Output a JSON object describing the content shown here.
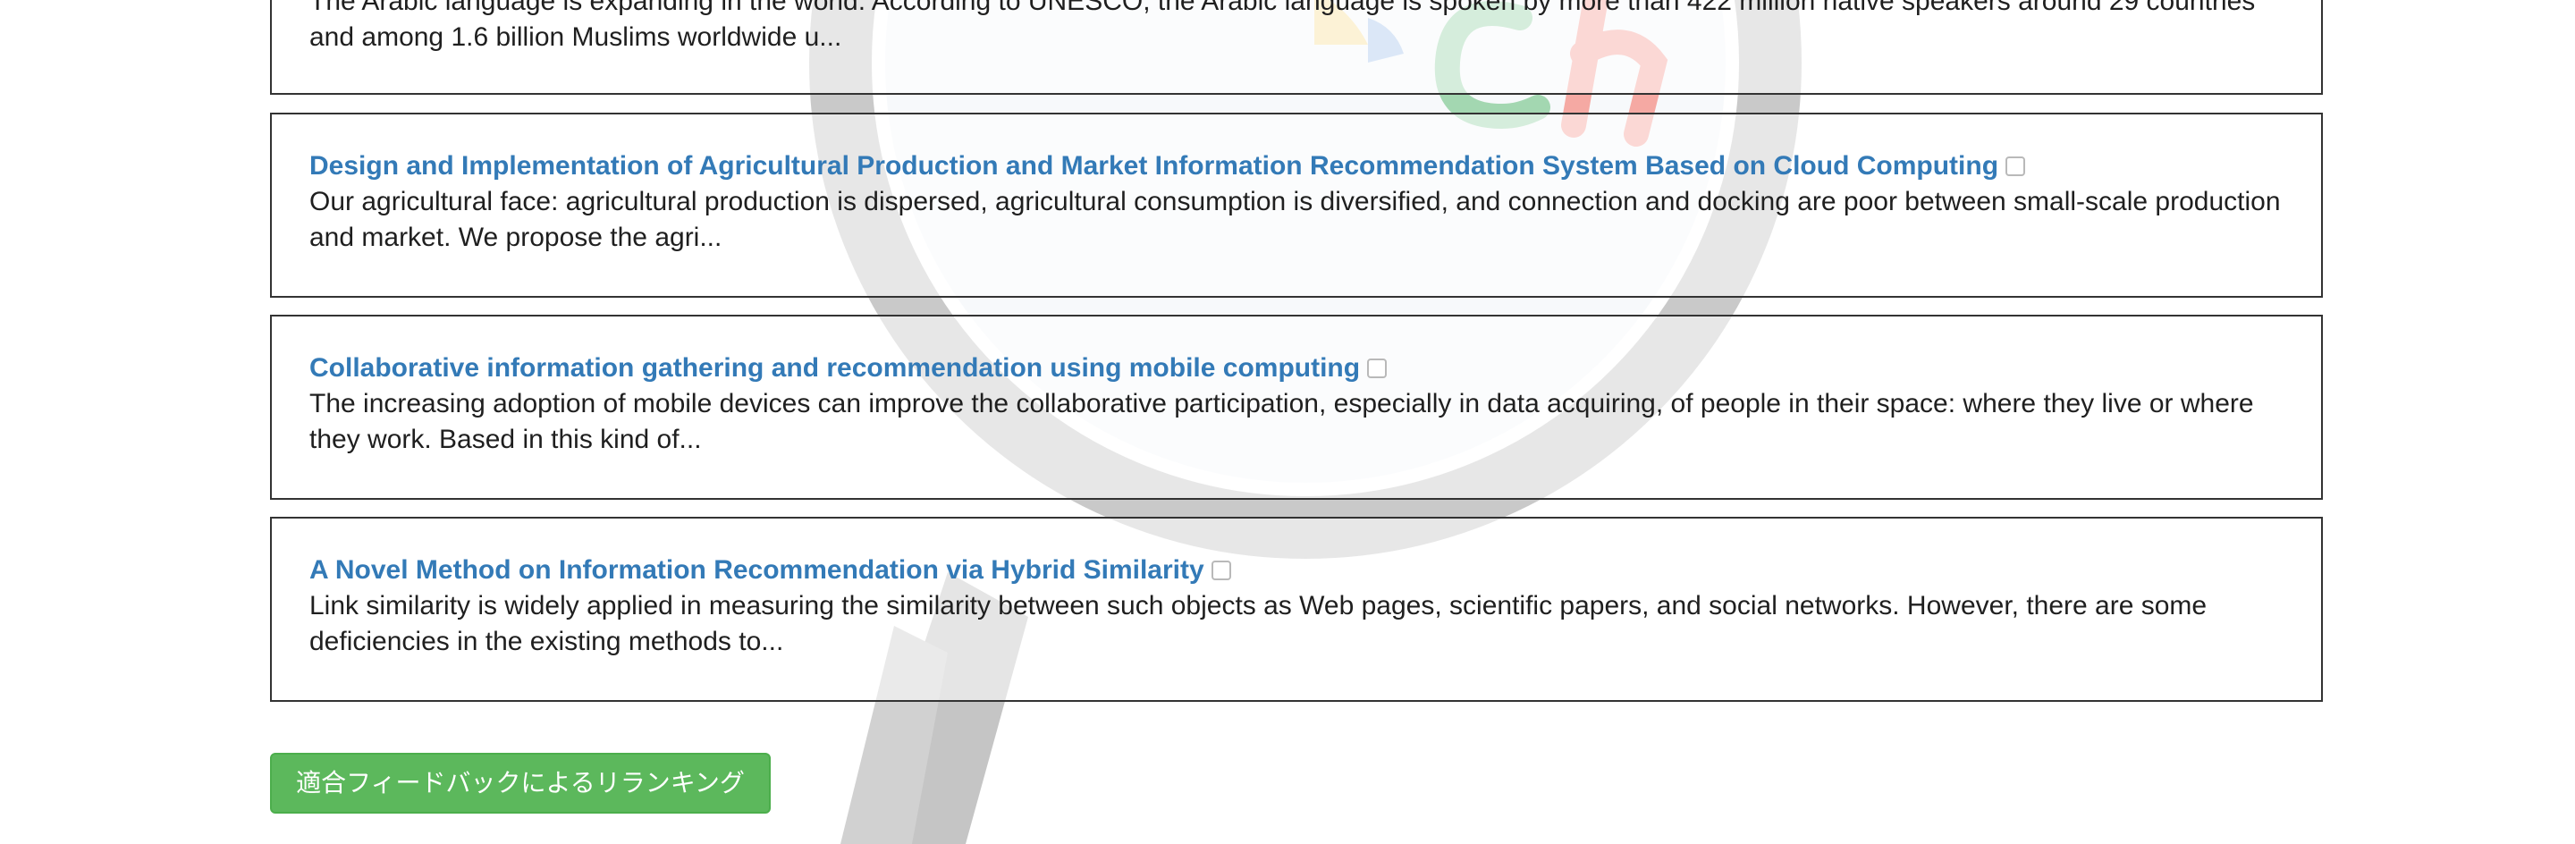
{
  "results": [
    {
      "title": "",
      "snippet": "The Arabic language is expanding in the world. According to UNESCO, the Arabic language is spoken by more than 422 million native speakers around 29 countries and among 1.6 billion Muslims worldwide u..."
    },
    {
      "title": "Design and Implementation of Agricultural Production and Market Information Recommendation System Based on Cloud Computing",
      "snippet": "Our agricultural face: agricultural production is dispersed, agricultural consumption is diversified, and connection and docking are poor between small-scale production and market. We propose the agri..."
    },
    {
      "title": "Collaborative information gathering and recommendation using mobile computing",
      "snippet": "The increasing adoption of mobile devices can improve the collaborative participation, especially in data acquiring, of people in their space: where they live or where they work. Based in this kind of..."
    },
    {
      "title": "A Novel Method on Information Recommendation via Hybrid Similarity",
      "snippet": "Link similarity is widely applied in measuring the similarity between such objects as Web pages, scientific papers, and social networks. However, there are some deficiencies in the existing methods to..."
    }
  ],
  "rerank_button_label": "適合フィードバックによるリランキング",
  "colors": {
    "link": "#337ab7",
    "button_bg": "#5cb85c",
    "border": "#333333"
  },
  "icons": {
    "background": "magnifier-illustration-icon",
    "checkbox": "relevance-checkbox"
  }
}
